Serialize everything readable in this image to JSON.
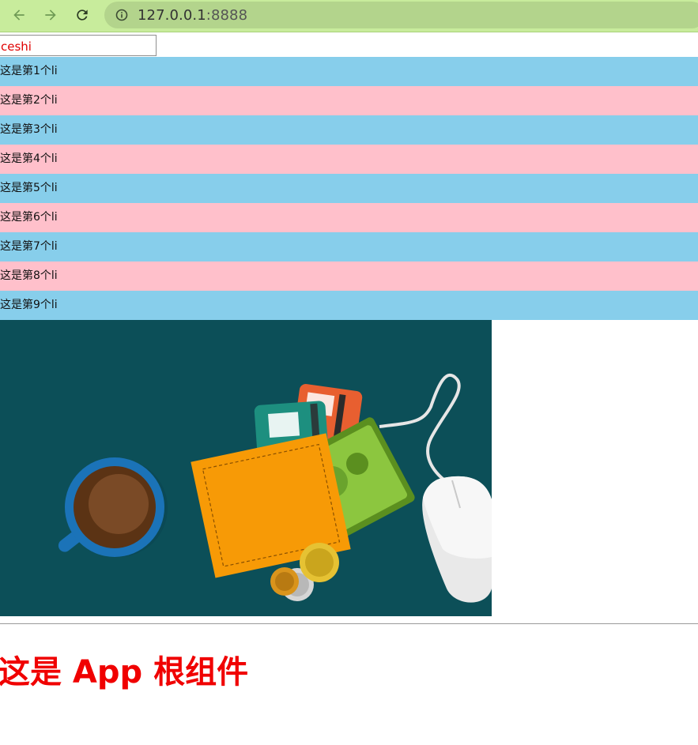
{
  "browser": {
    "url_host": "127.0.0.1",
    "url_port": ":8888"
  },
  "input": {
    "value": "ceshi"
  },
  "list": {
    "items": [
      "这是第1个li",
      "这是第2个li",
      "这是第3个li",
      "这是第4个li",
      "这是第5个li",
      "这是第6个li",
      "这是第7个li",
      "这是第8个li",
      "这是第9个li"
    ],
    "odd_color": "#87ceeb",
    "even_color": "#ffc0cb"
  },
  "illustration": {
    "subject": "flat illustration with coffee cup, wallet with cards and cash, coins, computer mouse"
  },
  "heading": {
    "text": "这是 App 根组件",
    "color": "#ff0000"
  }
}
